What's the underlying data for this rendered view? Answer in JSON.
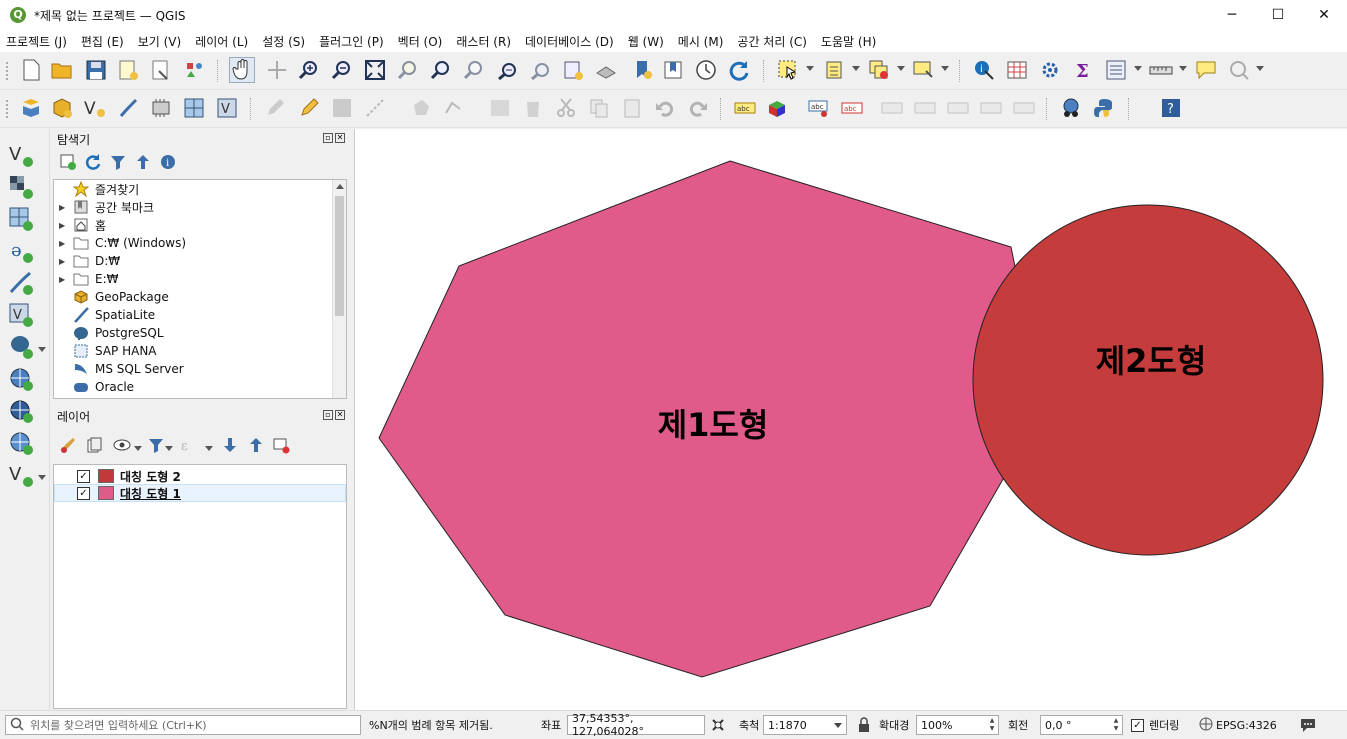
{
  "window": {
    "title": "*제목 없는 프로젝트 — QGIS",
    "logo_letter": "Q",
    "minimize": "─",
    "maximize": "☐",
    "close": "✕"
  },
  "menu": [
    "프로젝트 (J)",
    "편집 (E)",
    "보기 (V)",
    "레이어 (L)",
    "설정 (S)",
    "플러그인 (P)",
    "벡터 (O)",
    "래스터 (R)",
    "데이터베이스 (D)",
    "웹 (W)",
    "메시 (M)",
    "공간 처리 (C)",
    "도움말 (H)"
  ],
  "browser": {
    "title": "탐색기",
    "items": [
      {
        "label": "즐겨찾기",
        "icon": "star-icon",
        "expandable": false
      },
      {
        "label": "공간 북마크",
        "icon": "bookmark-icon",
        "expandable": true
      },
      {
        "label": "홈",
        "icon": "home-icon",
        "expandable": true
      },
      {
        "label": "C:₩ (Windows)",
        "icon": "folder-icon",
        "expandable": true
      },
      {
        "label": "D:₩",
        "icon": "folder-icon",
        "expandable": true
      },
      {
        "label": "E:₩",
        "icon": "folder-icon",
        "expandable": true
      },
      {
        "label": "GeoPackage",
        "icon": "geopackage-icon",
        "expandable": false
      },
      {
        "label": "SpatiaLite",
        "icon": "spatialite-icon",
        "expandable": false
      },
      {
        "label": "PostgreSQL",
        "icon": "postgresql-icon",
        "expandable": false
      },
      {
        "label": "SAP HANA",
        "icon": "sap-hana-icon",
        "expandable": false
      },
      {
        "label": "MS SQL Server",
        "icon": "mssql-icon",
        "expandable": false
      },
      {
        "label": "Oracle",
        "icon": "oracle-icon",
        "expandable": false
      }
    ]
  },
  "layers": {
    "title": "레이어",
    "items": [
      {
        "label": "대칭 도형 2",
        "checked": true,
        "color": "#c0393b",
        "selected": false
      },
      {
        "label": "대칭 도형 1",
        "checked": true,
        "color": "#e05a8a",
        "selected": true
      }
    ]
  },
  "map": {
    "features": [
      {
        "label": "제1도형",
        "color": "#e05a8a",
        "shape": "octagon"
      },
      {
        "label": "제2도형",
        "color": "#c53c3c",
        "shape": "circle"
      }
    ]
  },
  "status": {
    "search_placeholder": "위치를 찾으려면 입력하세요 (Ctrl+K)",
    "message": "%N개의 범례 항목 제거됨.",
    "coord_label": "좌표",
    "coord_value": "37,54353°, 127,064028°",
    "scale_label": "축척",
    "scale_value": "1:1870",
    "magnifier_label": "확대경",
    "magnifier_value": "100%",
    "rotation_label": "회전",
    "rotation_value": "0,0 °",
    "render_label": "렌더링",
    "render_checked": true,
    "crs": "EPSG:4326"
  }
}
